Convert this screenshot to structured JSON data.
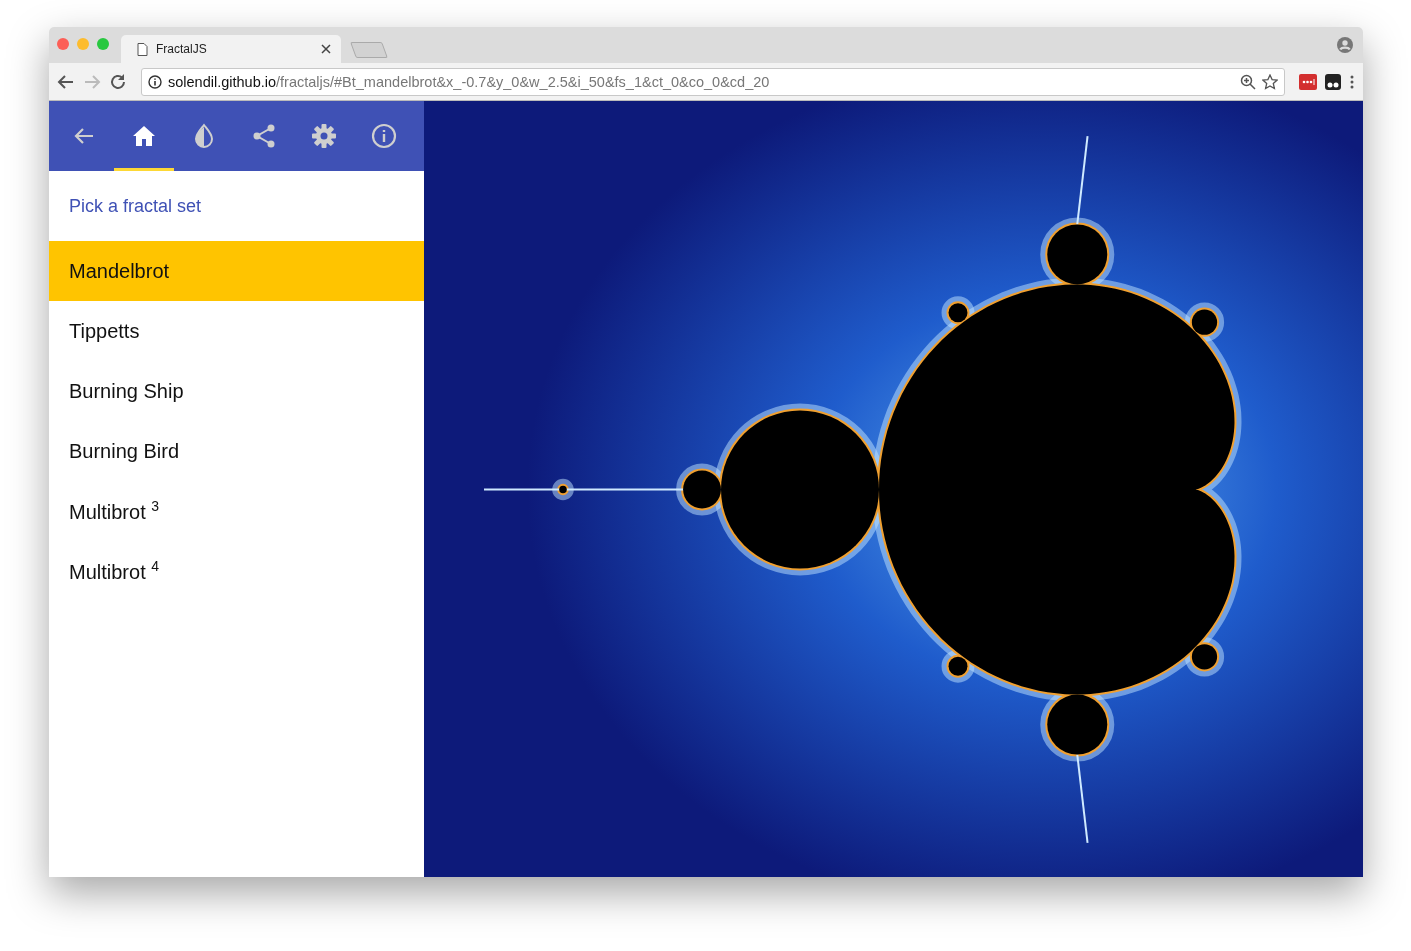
{
  "browser": {
    "tab_title": "FractalJS",
    "address": {
      "host": "solendil.github.io",
      "path": "/fractaljs/#Bt_mandelbrot&x_-0.7&y_0&w_2.5&i_50&fs_1&ct_0&co_0&cd_20"
    }
  },
  "toolbar": [
    {
      "kind": "back",
      "selected": false
    },
    {
      "kind": "home",
      "selected": true
    },
    {
      "kind": "palette",
      "selected": false
    },
    {
      "kind": "share",
      "selected": false
    },
    {
      "kind": "settings",
      "selected": false
    },
    {
      "kind": "info",
      "selected": false
    }
  ],
  "panel": {
    "heading": "Pick a fractal set",
    "items": [
      {
        "label": "Mandelbrot",
        "selected": true
      },
      {
        "label": "Tippetts",
        "selected": false
      },
      {
        "label": "Burning Ship",
        "selected": false
      },
      {
        "label": "Burning Bird",
        "selected": false
      },
      {
        "label": "Multibrot $^{3}$",
        "selected": false
      },
      {
        "label": "Multibrot $^{4}$",
        "selected": false
      }
    ]
  }
}
